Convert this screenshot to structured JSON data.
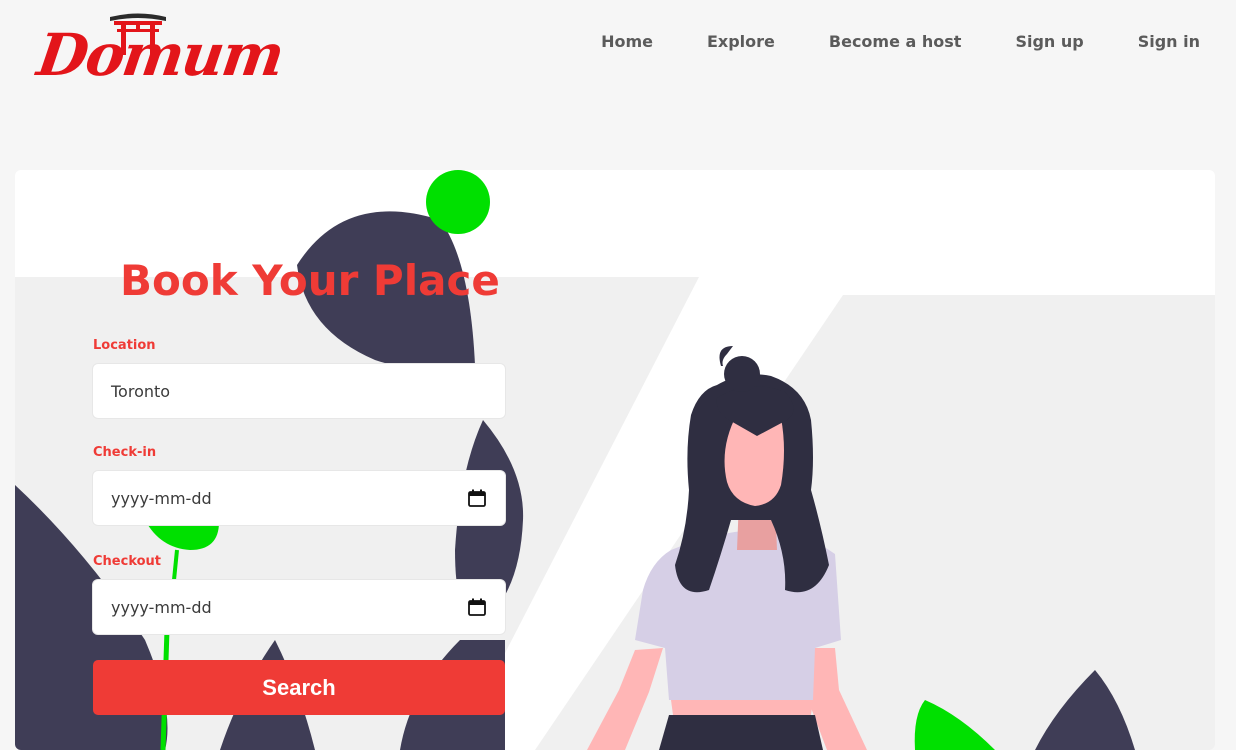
{
  "brand": {
    "logo_text": "Domum",
    "color": "#e3151a"
  },
  "nav": {
    "items": [
      {
        "label": "Home"
      },
      {
        "label": "Explore"
      },
      {
        "label": "Become a host"
      },
      {
        "label": "Sign up"
      },
      {
        "label": "Sign in"
      }
    ]
  },
  "booking": {
    "title": "Book Your Place",
    "location": {
      "label": "Location",
      "value": "Toronto"
    },
    "checkin": {
      "label": "Check-in",
      "placeholder": "yyyy-mm-dd",
      "icon": "calendar-icon"
    },
    "checkout": {
      "label": "Checkout",
      "placeholder": "yyyy-mm-dd",
      "icon": "calendar-icon"
    },
    "search_label": "Search"
  },
  "colors": {
    "accent": "#ef3b36",
    "illustration_dark": "#3f3d56",
    "illustration_green": "#00e000",
    "skin": "#ffb6b6",
    "shirt": "#d6cfe6"
  }
}
